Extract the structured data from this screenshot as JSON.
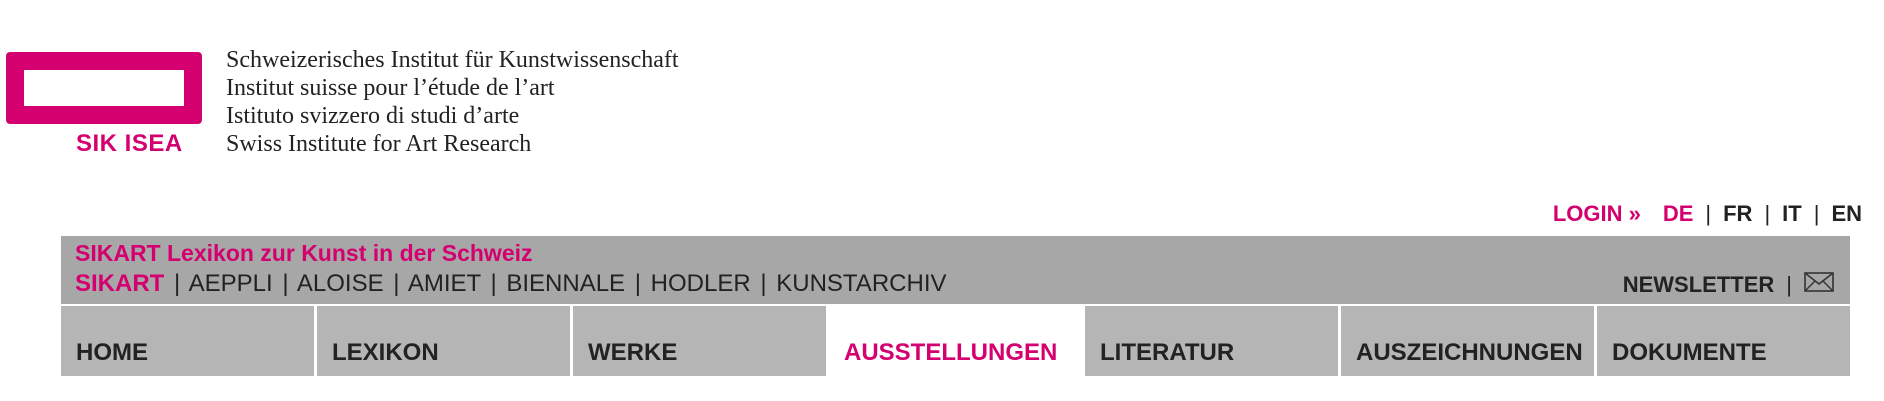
{
  "logo": {
    "text": "SIK ISEA",
    "color": "#d4006f"
  },
  "institute": {
    "lines": [
      "Schweizerisches Institut für Kunstwissenschaft",
      "Institut suisse pour l’étude de l’art",
      "Istituto svizzero di studi d’arte",
      "Swiss Institute for Art Research"
    ]
  },
  "lang_bar": {
    "login": "LOGIN »",
    "languages": [
      "DE",
      "FR",
      "IT",
      "EN"
    ],
    "active": "DE",
    "separator": "|"
  },
  "subheader": {
    "title": "SIKART Lexikon zur Kunst in der Schweiz",
    "sites": [
      "SIKART",
      "AEPPLI",
      "ALOISE",
      "AMIET",
      "BIENNALE",
      "HODLER",
      "KUNSTARCHIV"
    ],
    "active_site": "SIKART",
    "separator": "|",
    "newsletter": "NEWSLETTER",
    "newsletter_icon": "envelope-icon"
  },
  "nav": {
    "tabs": [
      "HOME",
      "LEXIKON",
      "WERKE",
      "AUSSTELLUNGEN",
      "LITERATUR",
      "AUSZEICHNUNGEN",
      "DOKUMENTE"
    ],
    "active": "AUSSTELLUNGEN"
  },
  "colors": {
    "accent": "#d4006f",
    "bar": "#a7a7a7",
    "tab": "#b5b5b5"
  }
}
